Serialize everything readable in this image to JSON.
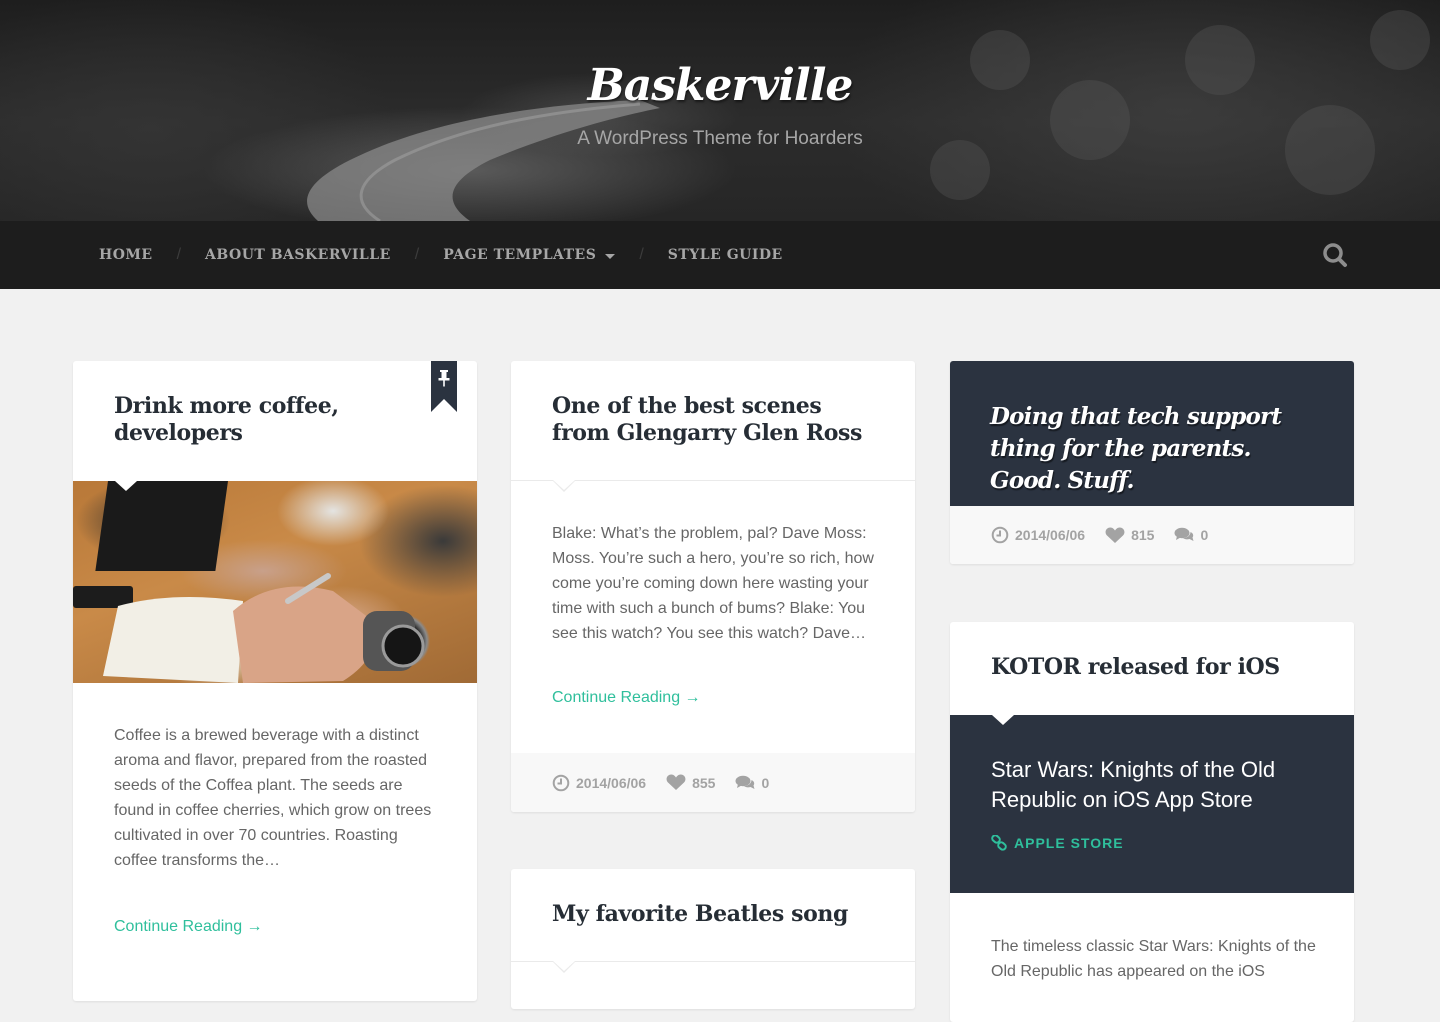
{
  "site": {
    "title": "Baskerville",
    "description": "A WordPress Theme for Hoarders"
  },
  "nav": {
    "items": [
      {
        "label": "Home"
      },
      {
        "label": "About Baskerville"
      },
      {
        "label": "Page Templates",
        "has_dropdown": true
      },
      {
        "label": "Style Guide"
      }
    ],
    "separator": "/",
    "search_icon": "search-icon"
  },
  "colors": {
    "accent": "#2fbf9c",
    "dark_panel": "#2b3340",
    "nav_bg": "#1d1d1d",
    "page_bg": "#f1f1f1"
  },
  "posts": [
    {
      "title": "Drink more coffee, developers",
      "sticky": true,
      "sticky_icon": "pin-icon",
      "image_alt": "Hand writing in a notebook next to a laptop",
      "excerpt": "Coffee is a brewed beverage with a distinct aroma and flavor, prepared from the roasted seeds of the Coffea plant. The seeds are found in coffee cherries, which grow on trees cultivated in over 70 countries. Roasting coffee transforms the…",
      "more_label": "Continue Reading →"
    },
    {
      "title": "One of the best scenes from Glengarry Glen Ross",
      "excerpt": "Blake: What’s the problem, pal? Dave Moss: Moss. You’re such a hero, you’re so rich, how come you’re coming down here wasting your time with such a bunch of bums? Blake: You see this watch? You see this watch? Dave…",
      "more_label": "Continue Reading →",
      "meta": {
        "date": "2014/06/06",
        "likes": "855",
        "comments": "0"
      }
    },
    {
      "title": "My favorite Beatles song"
    },
    {
      "quote": "Doing that tech support thing for the parents. Good. Stuff.",
      "meta": {
        "date": "2014/06/06",
        "likes": "815",
        "comments": "0"
      }
    },
    {
      "title": "KOTOR released for iOS",
      "link_title": "Star Wars: Knights of the Old Republic on iOS App Store",
      "link_label": "Apple Store",
      "excerpt": "The timeless classic Star Wars: Knights of the Old Republic has appeared on the iOS"
    }
  ]
}
